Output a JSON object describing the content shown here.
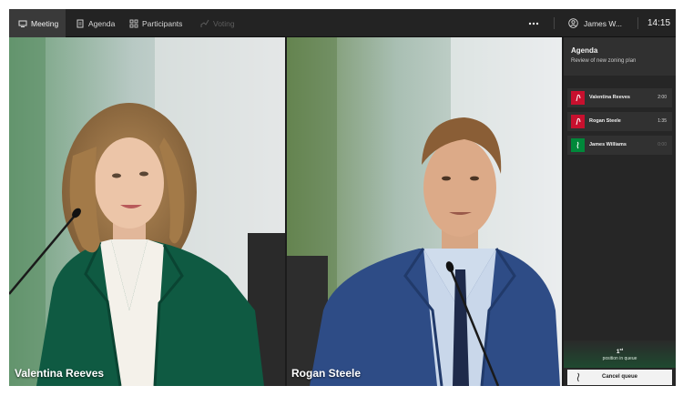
{
  "topbar": {
    "tabs": [
      {
        "label": "Meeting",
        "icon": "meeting-icon",
        "state": "active"
      },
      {
        "label": "Agenda",
        "icon": "document-icon",
        "state": "normal"
      },
      {
        "label": "Participants",
        "icon": "participants-icon",
        "state": "normal"
      },
      {
        "label": "Voting",
        "icon": "voting-icon",
        "state": "disabled"
      }
    ],
    "more_icon": "more-icon",
    "user": {
      "name": "James W...",
      "icon": "user-icon"
    },
    "clock": "14:15"
  },
  "video": {
    "left_name": "Valentina Reeves",
    "right_name": "Rogan Steele"
  },
  "panel": {
    "title": "Agenda",
    "subtitle": "Review of new zoning plan",
    "speakers": [
      {
        "name": "Valentina Reeves",
        "time": "2:00",
        "status": "speaking",
        "color": "#c8102e"
      },
      {
        "name": "Rogan Steele",
        "time": "1:35",
        "status": "speaking",
        "color": "#c8102e"
      },
      {
        "name": "James Williams",
        "time": "0:00",
        "status": "waiting",
        "color": "#00883a"
      }
    ],
    "queue": {
      "position": "1",
      "position_suffix": "st",
      "label": "position in queue"
    },
    "cancel_label": "Cancel queue"
  },
  "colors": {
    "speaking": "#c8102e",
    "waiting": "#00883a",
    "accent_green": "#1f4a30"
  }
}
